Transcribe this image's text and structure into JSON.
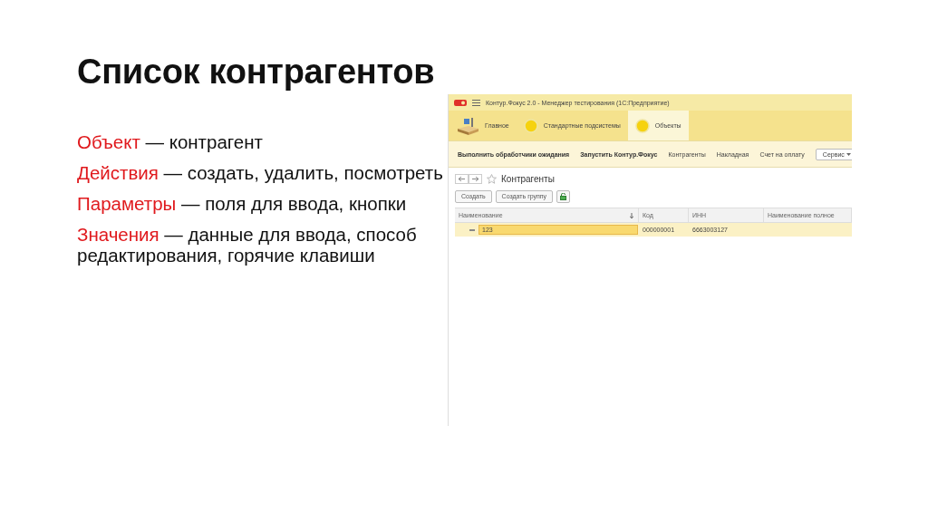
{
  "slide": {
    "title": "Список контрагентов",
    "points": [
      {
        "term": "Объект",
        "text": "— контрагент"
      },
      {
        "term": "Действия",
        "text": "— создать, удалить, посмотреть"
      },
      {
        "term": "Параметры",
        "text": "— поля для ввода, кнопки"
      },
      {
        "term": "Значения",
        "text": "— данные для ввода, способ редактирования, горячие клавиши"
      }
    ]
  },
  "app": {
    "window": {
      "title": "Контур.Фокус 2.0  - Менеджер тестирования (1С:Предприятие)"
    },
    "sections": [
      {
        "label": "Главное",
        "kind": "desk",
        "selected": false
      },
      {
        "label": "Стандартные подсистемы",
        "kind": "circle",
        "selected": false
      },
      {
        "label": "Объекты",
        "kind": "circle",
        "selected": true
      }
    ],
    "commands": [
      {
        "label": "Выполнить обработчики ожидания",
        "kind": "bold"
      },
      {
        "label": "Запустить Контур.Фокус",
        "kind": "bold"
      },
      {
        "label": "Контрагенты",
        "kind": "link"
      },
      {
        "label": "Накладная",
        "kind": "link"
      },
      {
        "label": "Счет на оплату",
        "kind": "link"
      },
      {
        "label": "Сервис",
        "kind": "menu"
      }
    ],
    "form": {
      "title": "Контрагенты",
      "buttons": [
        {
          "label": "Создать"
        },
        {
          "label": "Создать группу"
        }
      ],
      "table": {
        "columns": [
          {
            "label": "Наименование",
            "sorted": true
          },
          {
            "label": "Код",
            "sorted": false
          },
          {
            "label": "ИНН",
            "sorted": false
          },
          {
            "label": "Наименование полное",
            "sorted": false
          }
        ],
        "rows": [
          {
            "cells": [
              "123",
              "000000001",
              "6663003127",
              ""
            ],
            "selected": true
          }
        ]
      }
    }
  }
}
